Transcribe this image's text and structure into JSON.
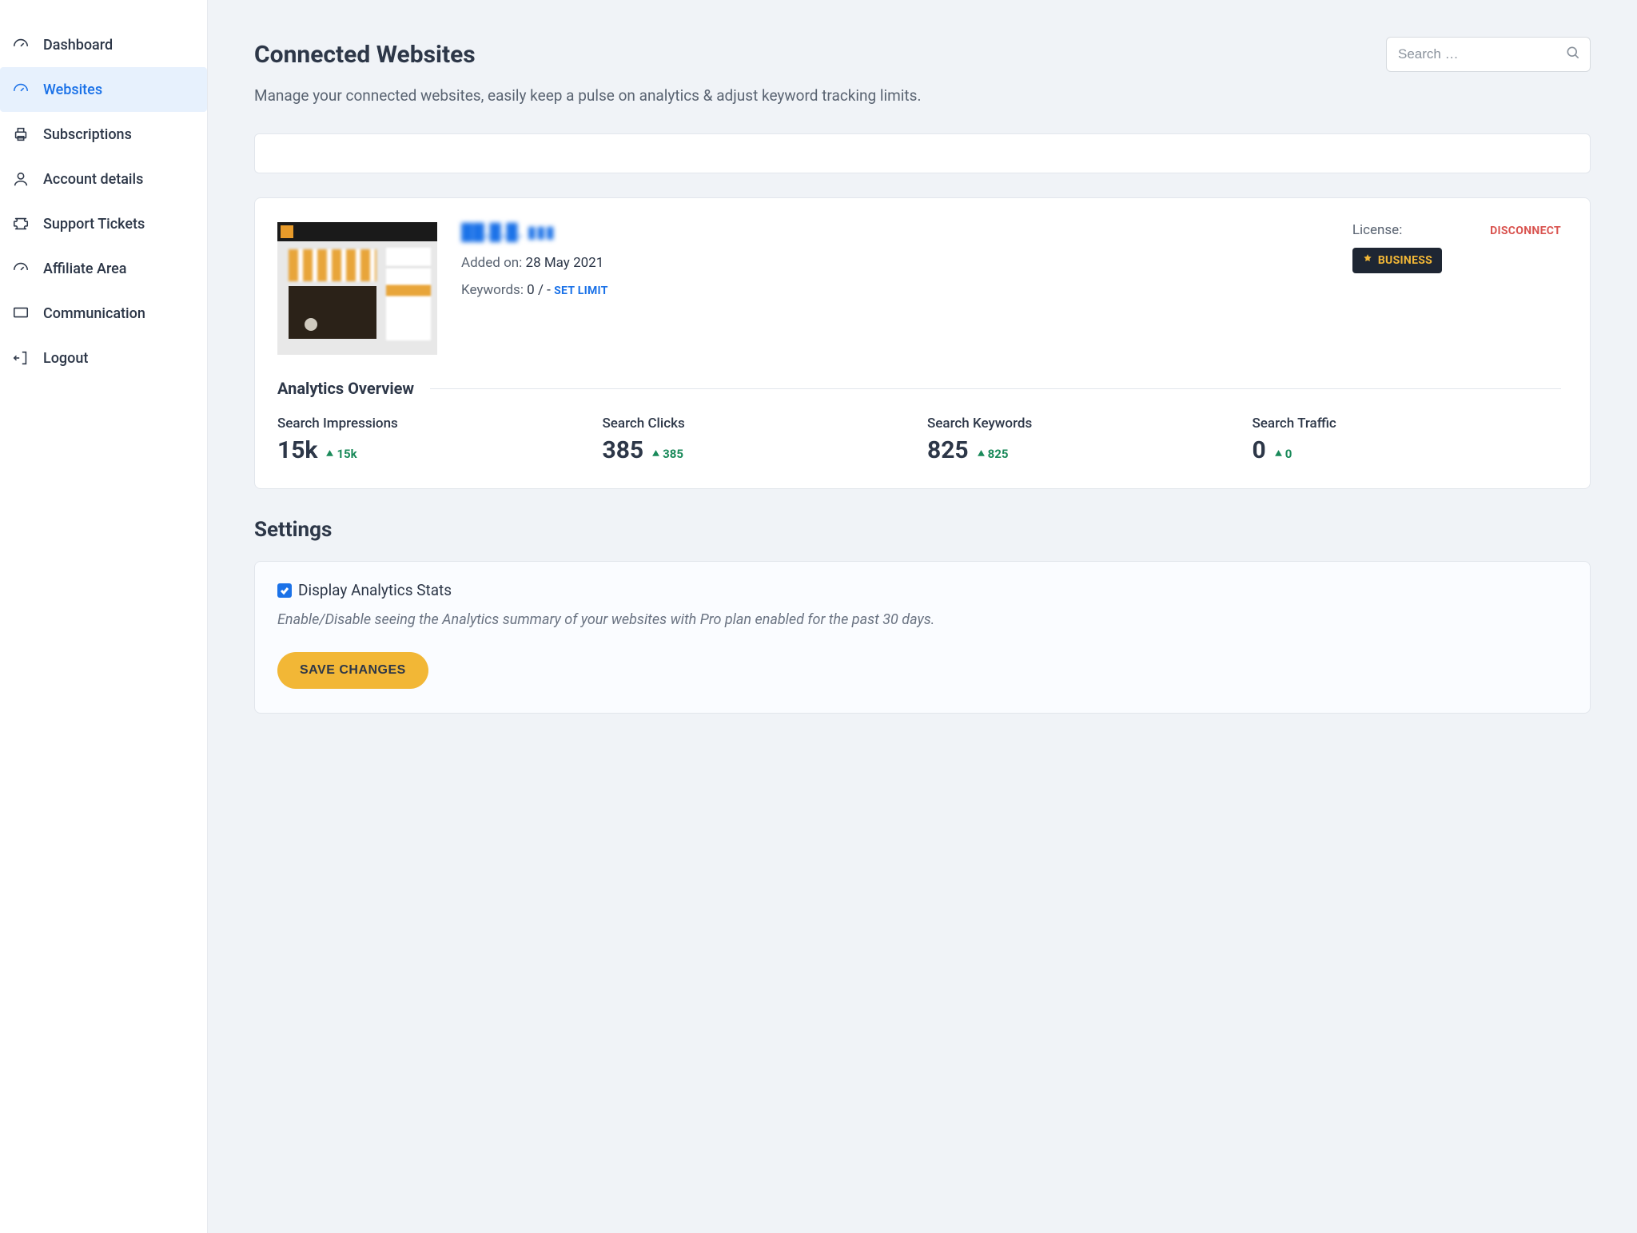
{
  "sidebar": {
    "items": [
      {
        "label": "Dashboard"
      },
      {
        "label": "Websites"
      },
      {
        "label": "Subscriptions"
      },
      {
        "label": "Account details"
      },
      {
        "label": "Support Tickets"
      },
      {
        "label": "Affiliate Area"
      },
      {
        "label": "Communication"
      },
      {
        "label": "Logout"
      }
    ]
  },
  "header": {
    "title": "Connected Websites",
    "subtitle": "Manage your connected websites, easily keep a pulse on analytics & adjust keyword tracking limits.",
    "search_placeholder": "Search …"
  },
  "site": {
    "url_masked": "██.█.█. ▮▮▮",
    "added_on_label": "Added on:",
    "added_on_value": "28 May 2021",
    "keywords_label": "Keywords:",
    "keywords_value": "0 / -",
    "set_limit": "SET LIMIT",
    "license_label": "License:",
    "license_badge": "BUSINESS",
    "disconnect": "DISCONNECT"
  },
  "analytics": {
    "title": "Analytics Overview",
    "stats": [
      {
        "label": "Search Impressions",
        "value": "15k",
        "delta": "15k"
      },
      {
        "label": "Search Clicks",
        "value": "385",
        "delta": "385"
      },
      {
        "label": "Search Keywords",
        "value": "825",
        "delta": "825"
      },
      {
        "label": "Search Traffic",
        "value": "0",
        "delta": "0"
      }
    ]
  },
  "settings": {
    "title": "Settings",
    "checkbox_label": "Display Analytics Stats",
    "help": "Enable/Disable seeing the Analytics summary of your websites with Pro plan enabled for the past 30 days.",
    "save": "SAVE CHANGES"
  }
}
